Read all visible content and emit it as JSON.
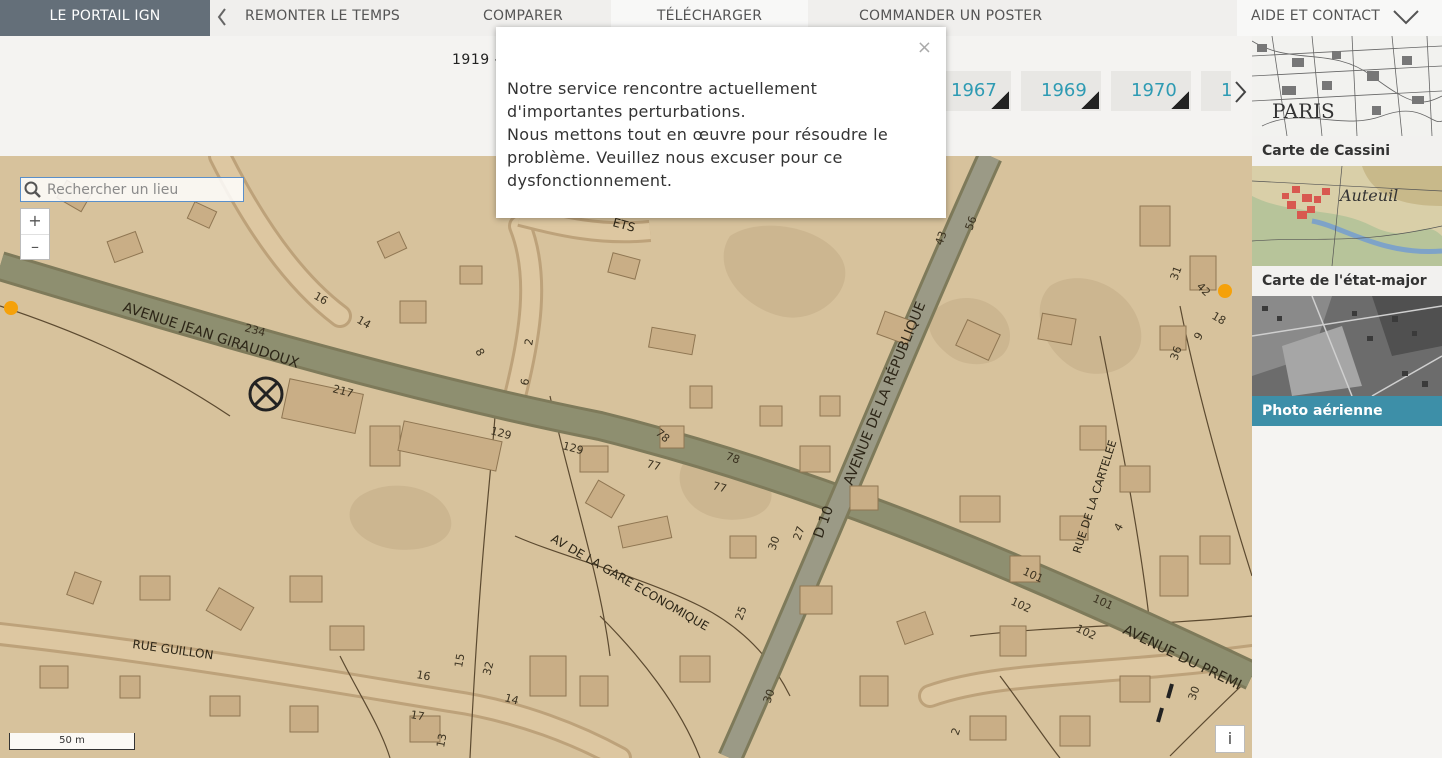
{
  "nav": {
    "portail": "LE PORTAIL IGN",
    "remonter": "REMONTER LE TEMPS",
    "comparer": "COMPARER",
    "telecharger": "TÉLÉCHARGER",
    "poster": "COMMANDER UN POSTER",
    "aide": "AIDE ET CONTACT"
  },
  "timeline": {
    "range": "1919 -",
    "years": [
      "1967",
      "1969",
      "1970",
      "1"
    ]
  },
  "layers": [
    {
      "label": "Carte de Cassini",
      "thumb_text": "PARIS",
      "active": false
    },
    {
      "label": "Carte de l'état-major",
      "thumb_text": "Auteuil",
      "active": false
    },
    {
      "label": "Photo aérienne",
      "active": true
    }
  ],
  "search": {
    "placeholder": "Rechercher un lieu"
  },
  "zoom": {
    "in": "+",
    "out": "–"
  },
  "scale": "50 m",
  "info": "i",
  "popup": {
    "close": "×",
    "line1": "Notre service rencontre actuellement d'importantes perturbations.",
    "line2": "Nous mettons tout en œuvre pour résoudre le problème. Veuillez nous excuser pour ce dysfonctionnement."
  },
  "map_labels": {
    "avenue_giraudoux": "AVENUE JEAN GIRAUDOUX",
    "avenue_republique": "AVENUE DE LA RÉPUBLIQUE",
    "d10": "D 10",
    "av_gare": "AV DE LA GARE ECONOMIQUE",
    "rue_guillon": "RUE GUILLON",
    "rue_cartelee": "RUE DE LA CARTELEE",
    "avenue_premier": "AVENUE DU PREMI",
    "street_fragment": "ETS",
    "house_numbers": [
      "234",
      "217",
      "16",
      "14",
      "8",
      "2",
      "6",
      "129",
      "129",
      "77",
      "77",
      "78",
      "78",
      "43",
      "56",
      "31",
      "42",
      "18",
      "9",
      "36",
      "30",
      "25",
      "27",
      "101",
      "101",
      "102",
      "102",
      "32",
      "16",
      "15",
      "14",
      "17",
      "13",
      "4",
      "2",
      "30",
      "30"
    ]
  },
  "colors": {
    "map_bg": "#d7c29c",
    "road": "#8e8f70",
    "accent": "#2e9bb3",
    "active_layer": "#3d8fa8",
    "nav_dark": "#646f79",
    "marker": "#f5a10a"
  }
}
